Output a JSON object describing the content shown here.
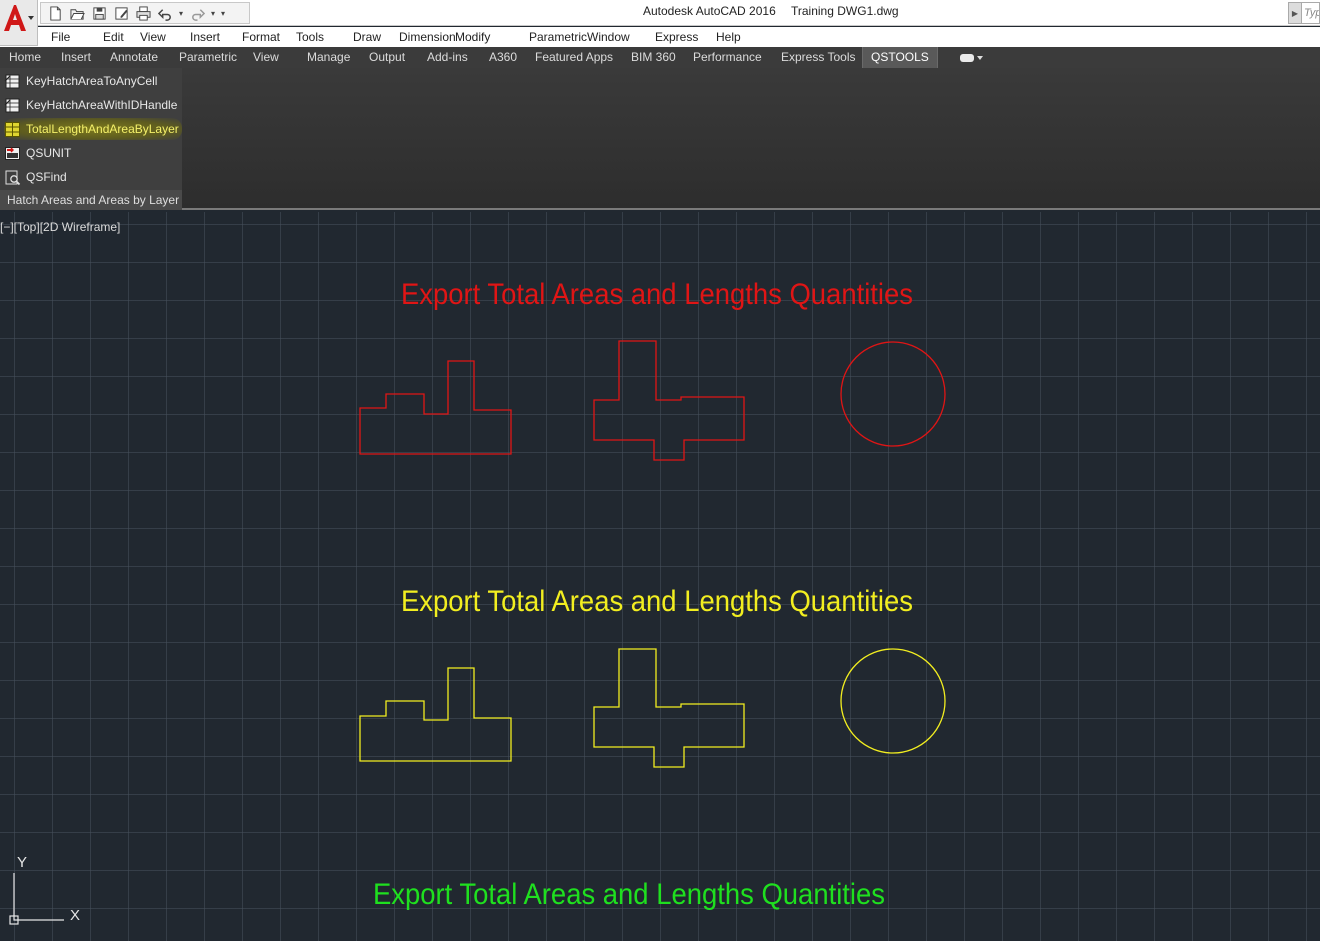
{
  "window": {
    "app_title": "Autodesk AutoCAD 2016",
    "file_title": "Training DWG1.dwg",
    "search_placeholder": "Typ"
  },
  "menu": [
    "File",
    "Edit",
    "View",
    "Insert",
    "Format",
    "Tools",
    "Draw",
    "Dimension",
    "Modify",
    "Parametric",
    "Window",
    "Express",
    "Help"
  ],
  "ribbon_tabs": [
    "Home",
    "Insert",
    "Annotate",
    "Parametric",
    "View",
    "Manage",
    "Output",
    "Add-ins",
    "A360",
    "Featured Apps",
    "BIM 360",
    "Performance",
    "Express Tools",
    "QSTOOLS"
  ],
  "active_tab": "QSTOOLS",
  "panel": {
    "title": "Hatch Areas and Areas by Layer",
    "commands": [
      {
        "label": "KeyHatchAreaToAnyCell",
        "icon": "hatch-table-icon"
      },
      {
        "label": "KeyHatchAreaWithIDHandle",
        "icon": "hatch-table-icon"
      },
      {
        "label": "TotalLengthAndAreaByLayer",
        "icon": "grid-table-icon",
        "highlighted": true
      },
      {
        "label": "QSUNIT",
        "icon": "unit-icon"
      },
      {
        "label": "QSFind",
        "icon": "find-icon"
      }
    ]
  },
  "viewport": {
    "label": "[−][Top][2D Wireframe]"
  },
  "drawing": {
    "groups": [
      {
        "heading": "Export Total Areas and Lengths Quantities",
        "color": "#e01515"
      },
      {
        "heading": "Export Total Areas and Lengths Quantities",
        "color": "#f2ee20"
      },
      {
        "heading": "Export Total Areas and Lengths Quantities",
        "color": "#1fe01f"
      }
    ]
  },
  "ucs": {
    "x_label": "X",
    "y_label": "Y"
  },
  "colors": {
    "canvas_bg": "#212830",
    "grid": "#46505c",
    "highlight": "#f4f06a"
  }
}
